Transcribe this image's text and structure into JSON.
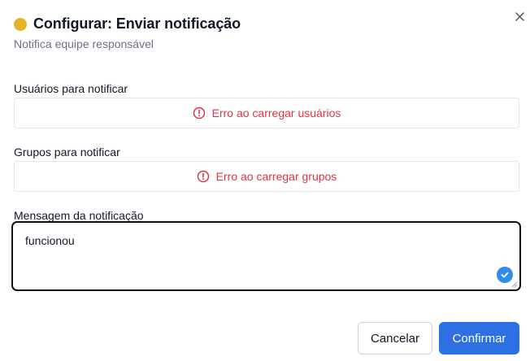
{
  "dialog": {
    "title": "Configurar: Enviar notificação",
    "subtitle": "Notifica equipe responsável",
    "status_color": "#e8b426"
  },
  "fields": {
    "users": {
      "label": "Usuários para notificar",
      "error": "Erro ao carregar usuários"
    },
    "groups": {
      "label": "Grupos para notificar",
      "error": "Erro ao carregar grupos"
    },
    "message": {
      "label": "Mensagem da notificação",
      "value": "funcionou"
    }
  },
  "actions": {
    "cancel_label": "Cancelar",
    "confirm_label": "Confirmar"
  },
  "colors": {
    "error": "#dc3545",
    "primary": "#2f6fe4",
    "valid_badge": "#2f8ce9"
  },
  "icons": {
    "close": "close-icon",
    "error": "alert-circle-icon",
    "valid": "check-circle-icon"
  }
}
